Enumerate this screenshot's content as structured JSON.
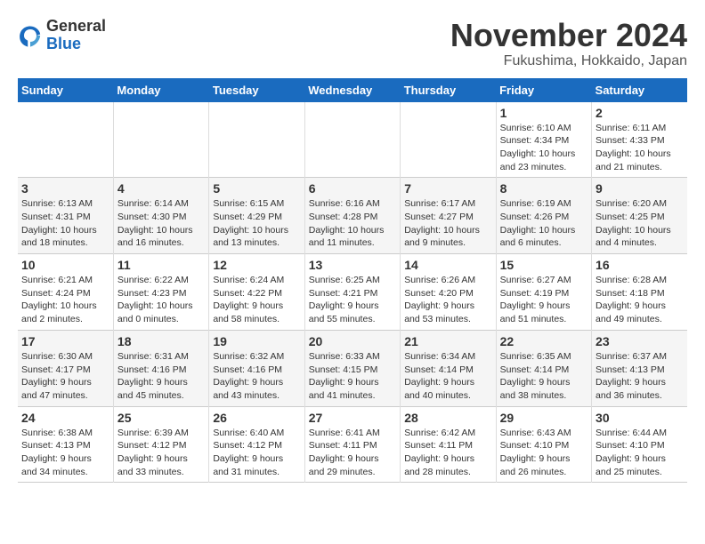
{
  "logo": {
    "general": "General",
    "blue": "Blue"
  },
  "title": "November 2024",
  "subtitle": "Fukushima, Hokkaido, Japan",
  "headers": [
    "Sunday",
    "Monday",
    "Tuesday",
    "Wednesday",
    "Thursday",
    "Friday",
    "Saturday"
  ],
  "weeks": [
    [
      {
        "day": "",
        "info": ""
      },
      {
        "day": "",
        "info": ""
      },
      {
        "day": "",
        "info": ""
      },
      {
        "day": "",
        "info": ""
      },
      {
        "day": "",
        "info": ""
      },
      {
        "day": "1",
        "info": "Sunrise: 6:10 AM\nSunset: 4:34 PM\nDaylight: 10 hours\nand 23 minutes."
      },
      {
        "day": "2",
        "info": "Sunrise: 6:11 AM\nSunset: 4:33 PM\nDaylight: 10 hours\nand 21 minutes."
      }
    ],
    [
      {
        "day": "3",
        "info": "Sunrise: 6:13 AM\nSunset: 4:31 PM\nDaylight: 10 hours\nand 18 minutes."
      },
      {
        "day": "4",
        "info": "Sunrise: 6:14 AM\nSunset: 4:30 PM\nDaylight: 10 hours\nand 16 minutes."
      },
      {
        "day": "5",
        "info": "Sunrise: 6:15 AM\nSunset: 4:29 PM\nDaylight: 10 hours\nand 13 minutes."
      },
      {
        "day": "6",
        "info": "Sunrise: 6:16 AM\nSunset: 4:28 PM\nDaylight: 10 hours\nand 11 minutes."
      },
      {
        "day": "7",
        "info": "Sunrise: 6:17 AM\nSunset: 4:27 PM\nDaylight: 10 hours\nand 9 minutes."
      },
      {
        "day": "8",
        "info": "Sunrise: 6:19 AM\nSunset: 4:26 PM\nDaylight: 10 hours\nand 6 minutes."
      },
      {
        "day": "9",
        "info": "Sunrise: 6:20 AM\nSunset: 4:25 PM\nDaylight: 10 hours\nand 4 minutes."
      }
    ],
    [
      {
        "day": "10",
        "info": "Sunrise: 6:21 AM\nSunset: 4:24 PM\nDaylight: 10 hours\nand 2 minutes."
      },
      {
        "day": "11",
        "info": "Sunrise: 6:22 AM\nSunset: 4:23 PM\nDaylight: 10 hours\nand 0 minutes."
      },
      {
        "day": "12",
        "info": "Sunrise: 6:24 AM\nSunset: 4:22 PM\nDaylight: 9 hours\nand 58 minutes."
      },
      {
        "day": "13",
        "info": "Sunrise: 6:25 AM\nSunset: 4:21 PM\nDaylight: 9 hours\nand 55 minutes."
      },
      {
        "day": "14",
        "info": "Sunrise: 6:26 AM\nSunset: 4:20 PM\nDaylight: 9 hours\nand 53 minutes."
      },
      {
        "day": "15",
        "info": "Sunrise: 6:27 AM\nSunset: 4:19 PM\nDaylight: 9 hours\nand 51 minutes."
      },
      {
        "day": "16",
        "info": "Sunrise: 6:28 AM\nSunset: 4:18 PM\nDaylight: 9 hours\nand 49 minutes."
      }
    ],
    [
      {
        "day": "17",
        "info": "Sunrise: 6:30 AM\nSunset: 4:17 PM\nDaylight: 9 hours\nand 47 minutes."
      },
      {
        "day": "18",
        "info": "Sunrise: 6:31 AM\nSunset: 4:16 PM\nDaylight: 9 hours\nand 45 minutes."
      },
      {
        "day": "19",
        "info": "Sunrise: 6:32 AM\nSunset: 4:16 PM\nDaylight: 9 hours\nand 43 minutes."
      },
      {
        "day": "20",
        "info": "Sunrise: 6:33 AM\nSunset: 4:15 PM\nDaylight: 9 hours\nand 41 minutes."
      },
      {
        "day": "21",
        "info": "Sunrise: 6:34 AM\nSunset: 4:14 PM\nDaylight: 9 hours\nand 40 minutes."
      },
      {
        "day": "22",
        "info": "Sunrise: 6:35 AM\nSunset: 4:14 PM\nDaylight: 9 hours\nand 38 minutes."
      },
      {
        "day": "23",
        "info": "Sunrise: 6:37 AM\nSunset: 4:13 PM\nDaylight: 9 hours\nand 36 minutes."
      }
    ],
    [
      {
        "day": "24",
        "info": "Sunrise: 6:38 AM\nSunset: 4:13 PM\nDaylight: 9 hours\nand 34 minutes."
      },
      {
        "day": "25",
        "info": "Sunrise: 6:39 AM\nSunset: 4:12 PM\nDaylight: 9 hours\nand 33 minutes."
      },
      {
        "day": "26",
        "info": "Sunrise: 6:40 AM\nSunset: 4:12 PM\nDaylight: 9 hours\nand 31 minutes."
      },
      {
        "day": "27",
        "info": "Sunrise: 6:41 AM\nSunset: 4:11 PM\nDaylight: 9 hours\nand 29 minutes."
      },
      {
        "day": "28",
        "info": "Sunrise: 6:42 AM\nSunset: 4:11 PM\nDaylight: 9 hours\nand 28 minutes."
      },
      {
        "day": "29",
        "info": "Sunrise: 6:43 AM\nSunset: 4:10 PM\nDaylight: 9 hours\nand 26 minutes."
      },
      {
        "day": "30",
        "info": "Sunrise: 6:44 AM\nSunset: 4:10 PM\nDaylight: 9 hours\nand 25 minutes."
      }
    ]
  ]
}
